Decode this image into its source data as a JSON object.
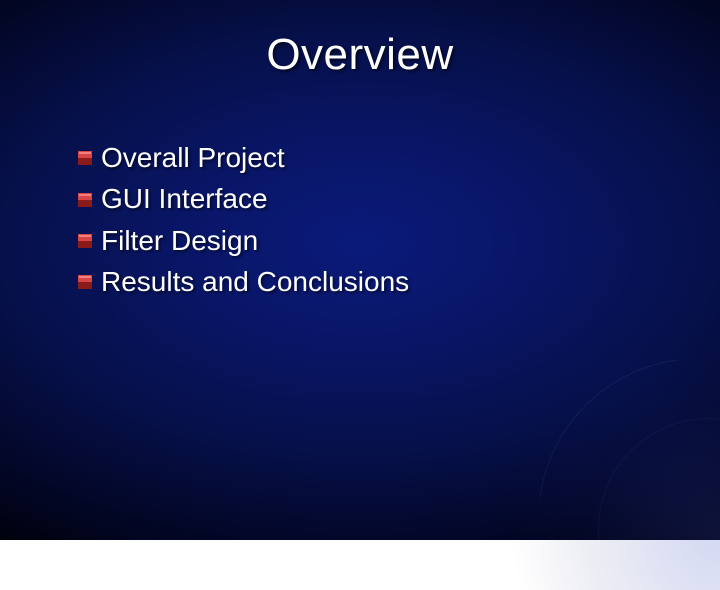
{
  "slide": {
    "title": "Overview",
    "bullets": [
      "Overall Project",
      "GUI Interface",
      "Filter Design",
      "Results and Conclusions"
    ]
  }
}
